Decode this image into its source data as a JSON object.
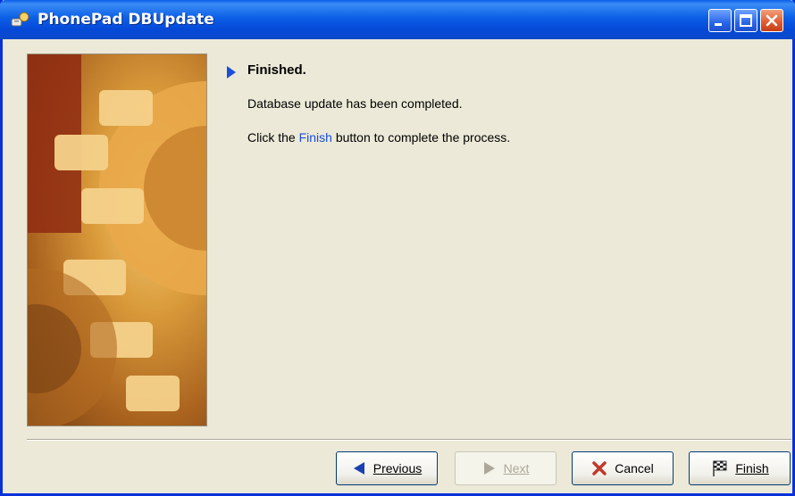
{
  "window": {
    "title": "PhonePad DBUpdate"
  },
  "titlebar_buttons": {
    "minimize": "minimize-icon",
    "maximize": "maximize-icon",
    "close": "close-icon"
  },
  "content": {
    "heading": "Finished.",
    "line1": "Database update has been completed.",
    "line2_before": "Click the ",
    "line2_link": "Finish",
    "line2_after": " button to complete the process."
  },
  "buttons": {
    "previous": "Previous",
    "next": "Next",
    "cancel": "Cancel",
    "finish": "Finish"
  },
  "colors": {
    "titlebar": "#0a5ee8",
    "window_bg": "#ece9d8",
    "link": "#1a4fd6",
    "cancel_x": "#c0392b"
  }
}
